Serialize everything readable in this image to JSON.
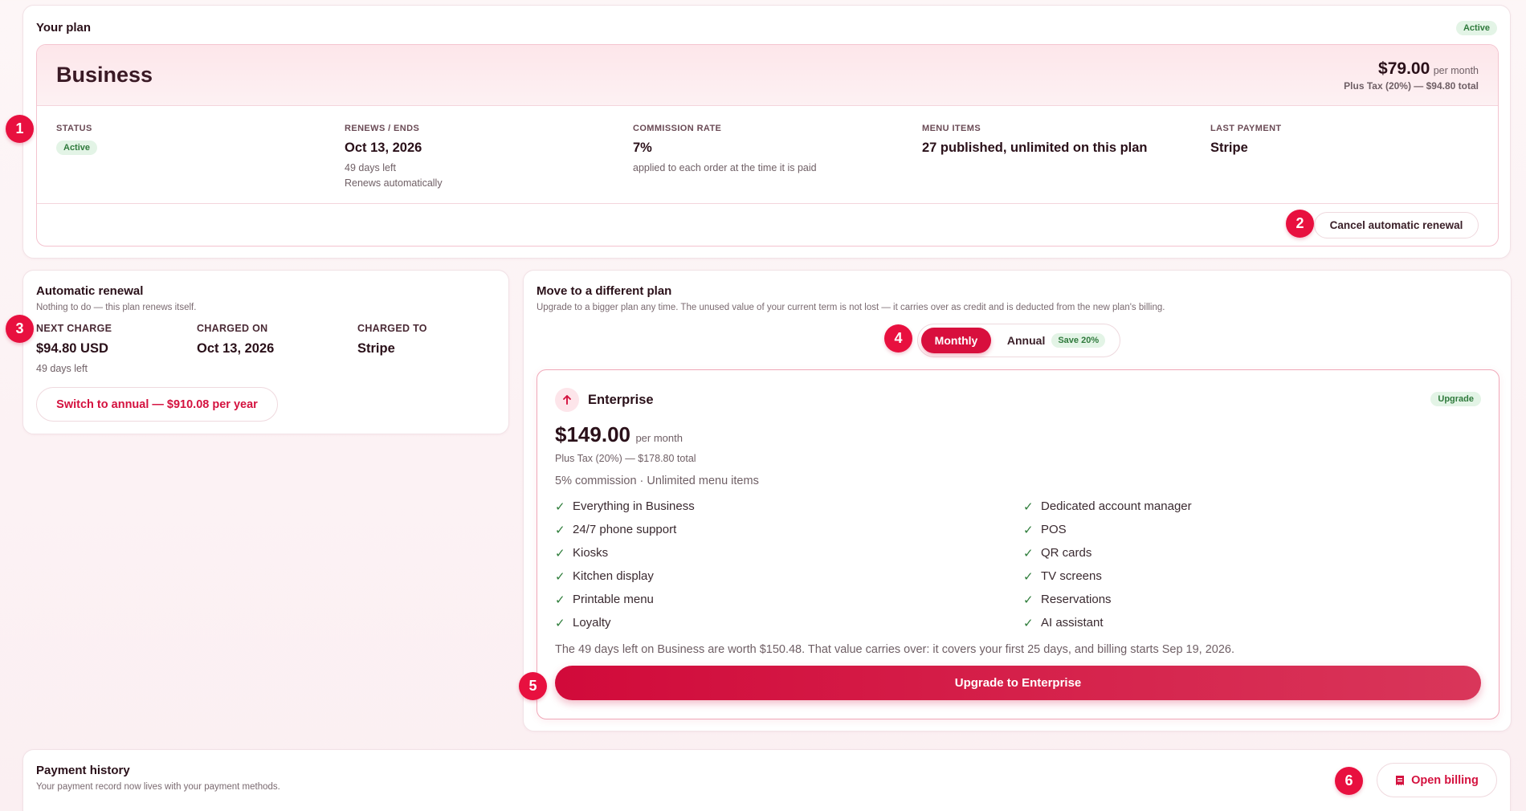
{
  "your_plan": {
    "title": "Your plan",
    "status_badge": "Active",
    "plan_name": "Business",
    "price": "$79.00",
    "price_period": "per month",
    "tax_note": "Plus Tax (20%) — $94.80 total",
    "details": {
      "status_label": "STATUS",
      "status_value": "Active",
      "renews_label": "RENEWS / ENDS",
      "renews_date": "Oct 13, 2026",
      "days_left": "49 days left",
      "renews_note": "Renews automatically",
      "commission_label": "COMMISSION RATE",
      "commission_value": "7%",
      "commission_note": "applied to each order at the time it is paid",
      "menu_label": "MENU ITEMS",
      "menu_value": "27 published, unlimited on this plan",
      "payment_label": "LAST PAYMENT",
      "payment_value": "Stripe"
    },
    "cancel_button": "Cancel automatic renewal"
  },
  "renewal": {
    "title": "Automatic renewal",
    "subtitle": "Nothing to do — this plan renews itself.",
    "next_charge_label": "NEXT CHARGE",
    "next_charge_value": "$94.80 USD",
    "next_charge_note": "49 days left",
    "charged_on_label": "CHARGED ON",
    "charged_on_value": "Oct 13, 2026",
    "charged_to_label": "CHARGED TO",
    "charged_to_value": "Stripe",
    "switch_button": "Switch to annual — $910.08 per year"
  },
  "move_plan": {
    "title": "Move to a different plan",
    "subtitle": "Upgrade to a bigger plan any time. The unused value of your current term is not lost — it carries over as credit and is deducted from the new plan's billing.",
    "toggle": {
      "monthly": "Monthly",
      "annual": "Annual",
      "save_badge": "Save 20%",
      "selected": "Monthly"
    },
    "enterprise": {
      "name": "Enterprise",
      "badge": "Upgrade",
      "price": "$149.00",
      "price_period": "per month",
      "tax_note": "Plus Tax (20%) — $178.80 total",
      "summary": "5% commission · Unlimited menu items",
      "features_left": [
        "Everything in Business",
        "24/7 phone support",
        "Kiosks",
        "Kitchen display",
        "Printable menu",
        "Loyalty"
      ],
      "features_right": [
        "Dedicated account manager",
        "POS",
        "QR cards",
        "TV screens",
        "Reservations",
        "AI assistant"
      ],
      "carryover_note": "The 49 days left on Business are worth $150.48. That value carries over: it covers your first 25 days, and billing starts Sep 19, 2026.",
      "upgrade_button": "Upgrade to Enterprise"
    }
  },
  "payment_history": {
    "title": "Payment history",
    "subtitle": "Your payment record now lives with your payment methods.",
    "open_billing_button": "Open billing"
  },
  "markers": [
    "1",
    "2",
    "3",
    "4",
    "5",
    "6"
  ],
  "colors": {
    "accent": "#e8103f",
    "accent_text": "#d4123f",
    "success_bg": "#e3f4e6",
    "success_text": "#2f7a3c",
    "upgrade_gradient_start": "#d10a3a",
    "upgrade_gradient_end": "#d9365a"
  },
  "icons": {
    "check": "check-icon",
    "arrow_up": "arrow-up-icon",
    "billing": "receipt-icon"
  }
}
